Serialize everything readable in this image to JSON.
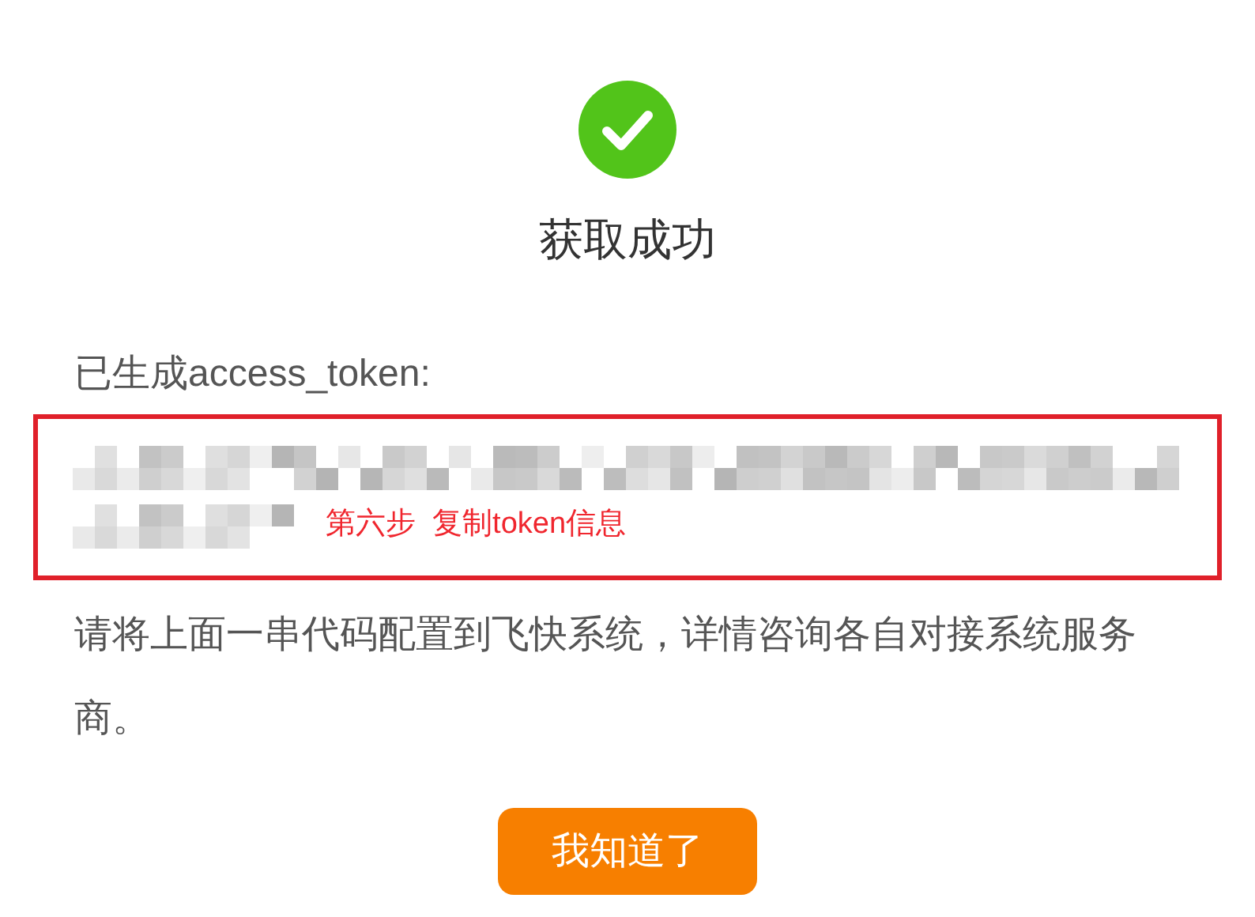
{
  "status": {
    "kind": "success",
    "title": "获取成功"
  },
  "token_label": "已生成access_token:",
  "annotation": "第六步  复制token信息",
  "message": "请将上面一串代码配置到飞快系统，详情咨询各自对接系统服务商。",
  "buttons": [
    "我知道了"
  ]
}
